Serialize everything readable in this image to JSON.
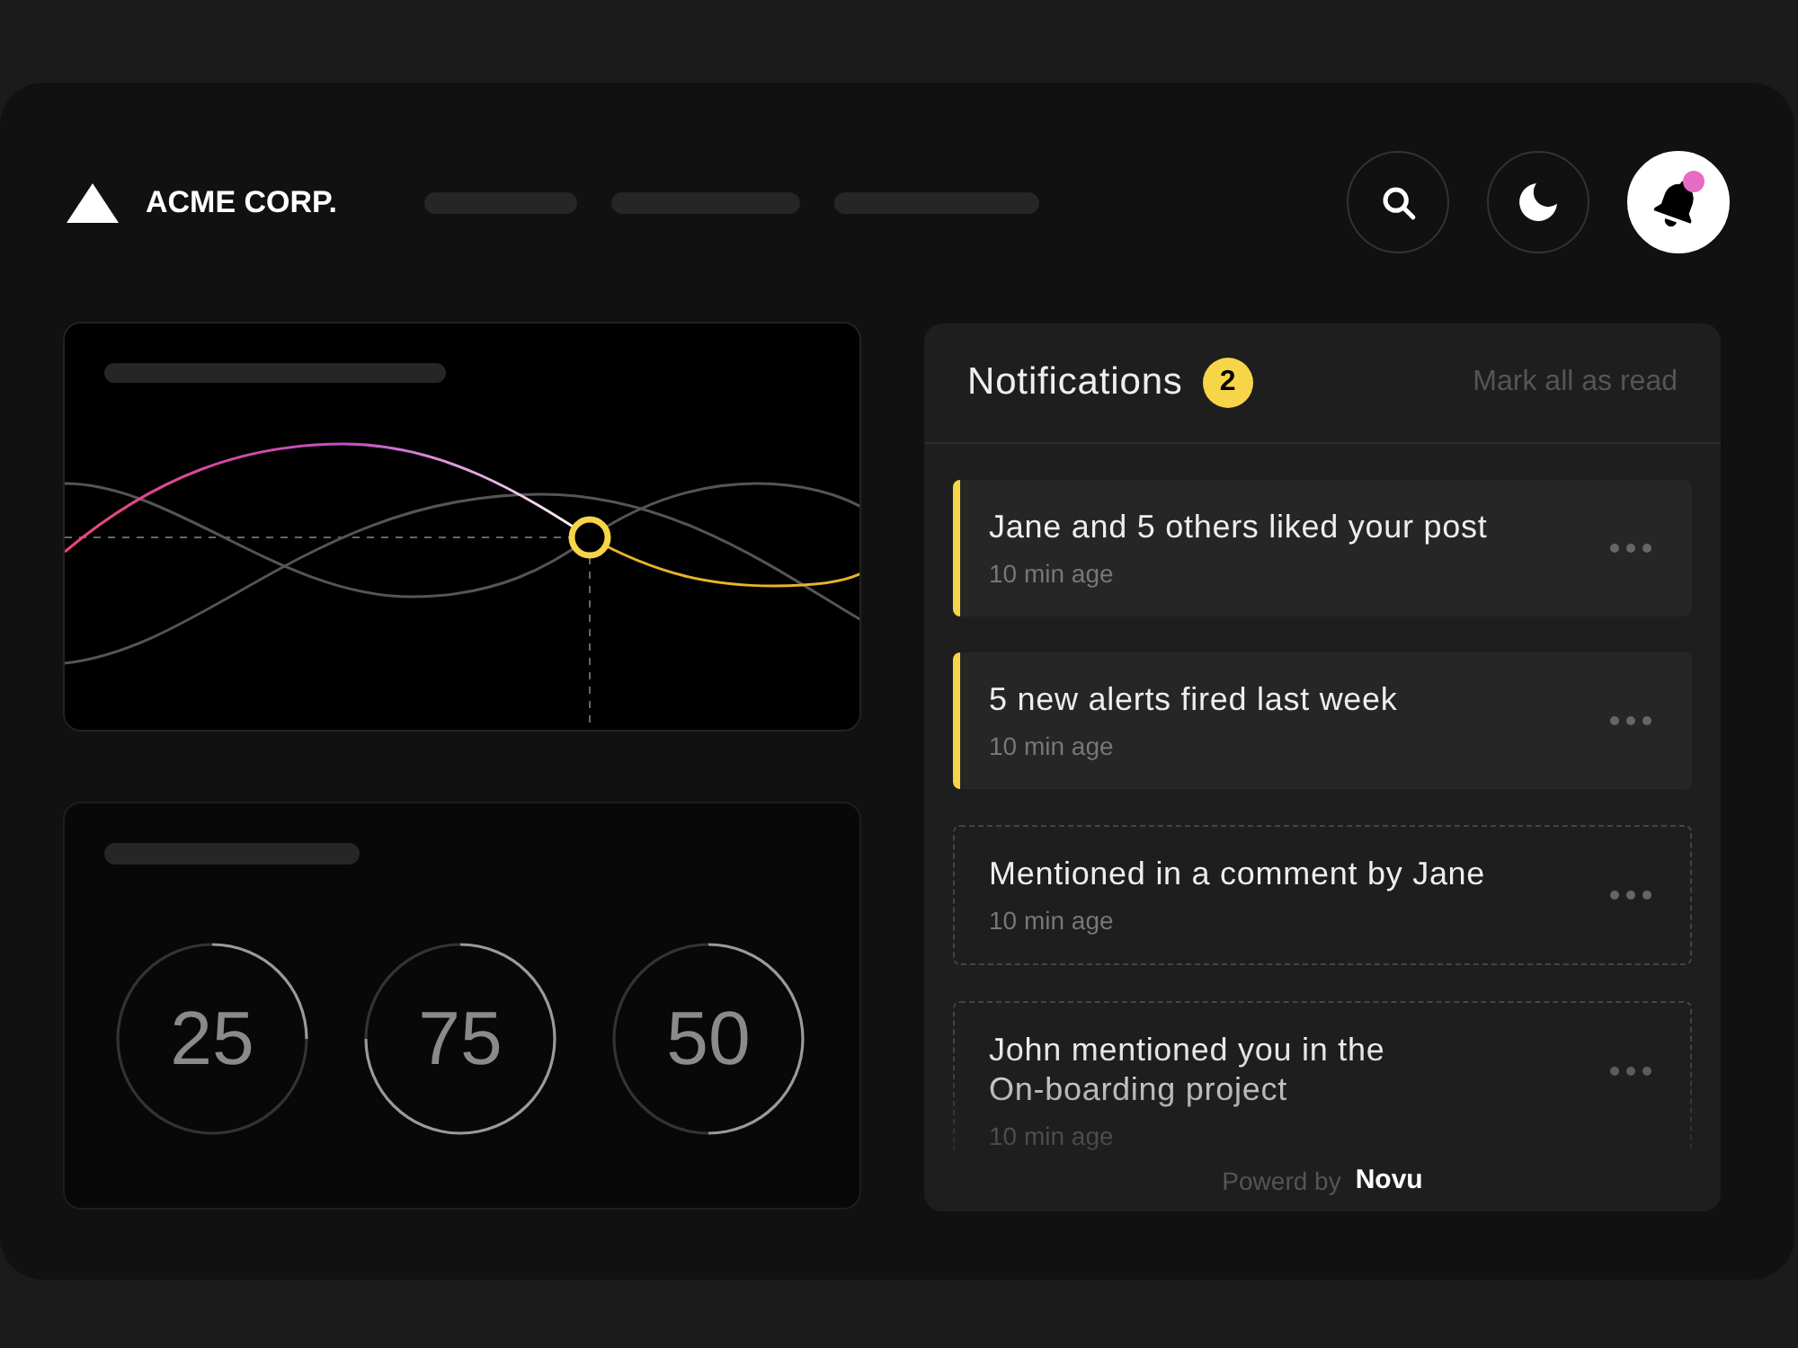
{
  "header": {
    "brand": "ACME CORP."
  },
  "header_buttons": [
    {
      "kind": "search",
      "selected": false,
      "unread": false
    },
    {
      "kind": "theme",
      "selected": false,
      "unread": false
    },
    {
      "kind": "notifications",
      "selected": true,
      "unread": true
    }
  ],
  "gauges": [
    {
      "value": "25",
      "chart_data": {
        "type": "donut",
        "values": [
          25,
          75
        ],
        "colors": [
          "#9a9a9a",
          "#333333"
        ]
      }
    },
    {
      "value": "75",
      "chart_data": {
        "type": "donut",
        "values": [
          75,
          25
        ],
        "colors": [
          "#9a9a9a",
          "#333333"
        ]
      }
    },
    {
      "value": "50",
      "chart_data": {
        "type": "donut",
        "values": [
          50,
          50
        ],
        "colors": [
          "#9a9a9a",
          "#333333"
        ]
      }
    }
  ],
  "notifications": {
    "title": "Notifications",
    "count": "2",
    "mark_all": "Mark all as read",
    "items": [
      {
        "text": "Jane and 5 others liked your post",
        "time": "10 min age",
        "read": false
      },
      {
        "text": "5 new alerts fired last week",
        "time": "10 min age",
        "read": false
      },
      {
        "text": "Mentioned in a comment by Jane",
        "time": "10 min age",
        "read": true
      },
      {
        "text": "John mentioned you in the On-boarding project",
        "time": "10 min age",
        "read": true
      }
    ],
    "footer": {
      "label": "Powerd by",
      "brand": "Novu"
    }
  }
}
